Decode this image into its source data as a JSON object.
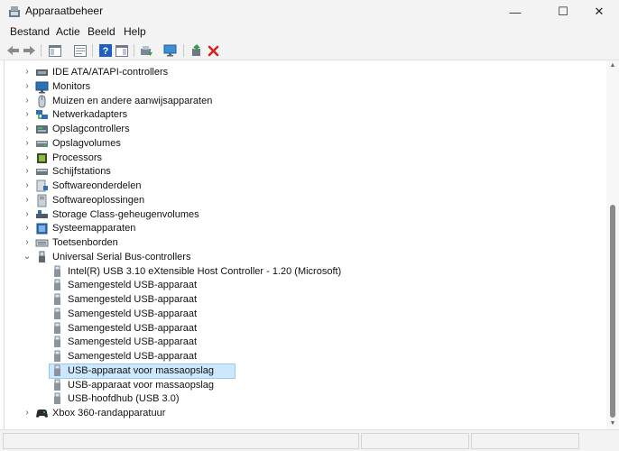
{
  "window": {
    "title": "Apparaatbeheer",
    "min": "—",
    "max": "☐",
    "close": "✕"
  },
  "menu": [
    "Bestand",
    "Actie",
    "Beeld",
    "Help"
  ],
  "toolbar": {
    "items": [
      "back-icon",
      "forward-icon",
      "show-hide-tree-icon",
      "properties-icon",
      "help-icon",
      "action-pane-icon",
      "update-driver-icon",
      "scan-hardware-icon",
      "enable-device-icon",
      "uninstall-icon"
    ]
  },
  "tree": [
    {
      "label": "IDE ATA/ATAPI-controllers",
      "icon": "ide-controller-icon",
      "level": 0,
      "chevron": "›"
    },
    {
      "label": "Monitors",
      "icon": "monitor-icon",
      "level": 0,
      "chevron": "›"
    },
    {
      "label": "Muizen en andere aanwijsapparaten",
      "icon": "mouse-icon",
      "level": 0,
      "chevron": "›"
    },
    {
      "label": "Netwerkadapters",
      "icon": "network-adapter-icon",
      "level": 0,
      "chevron": "›"
    },
    {
      "label": "Opslagcontrollers",
      "icon": "storage-controller-icon",
      "level": 0,
      "chevron": "›"
    },
    {
      "label": "Opslagvolumes",
      "icon": "storage-volume-icon",
      "level": 0,
      "chevron": "›"
    },
    {
      "label": "Processors",
      "icon": "processor-icon",
      "level": 0,
      "chevron": "›"
    },
    {
      "label": "Schijfstations",
      "icon": "disk-drive-icon",
      "level": 0,
      "chevron": "›"
    },
    {
      "label": "Softwareonderdelen",
      "icon": "software-component-icon",
      "level": 0,
      "chevron": "›"
    },
    {
      "label": "Softwareoplossingen",
      "icon": "software-solution-icon",
      "level": 0,
      "chevron": "›"
    },
    {
      "label": "Storage Class-geheugenvolumes",
      "icon": "storage-class-memory-icon",
      "level": 0,
      "chevron": "›"
    },
    {
      "label": "Systeemapparaten",
      "icon": "system-device-icon",
      "level": 0,
      "chevron": "›"
    },
    {
      "label": "Toetsenborden",
      "icon": "keyboard-icon",
      "level": 0,
      "chevron": "›"
    },
    {
      "label": "Universal Serial Bus-controllers",
      "icon": "usb-controller-icon",
      "level": 0,
      "chevron": "⌄"
    },
    {
      "label": "Intel(R) USB 3.10 eXtensible Host Controller - 1.20 (Microsoft)",
      "icon": "usb-device-icon",
      "level": 1
    },
    {
      "label": "Samengesteld USB-apparaat",
      "icon": "usb-device-icon",
      "level": 1
    },
    {
      "label": "Samengesteld USB-apparaat",
      "icon": "usb-device-icon",
      "level": 1
    },
    {
      "label": "Samengesteld USB-apparaat",
      "icon": "usb-device-icon",
      "level": 1
    },
    {
      "label": "Samengesteld USB-apparaat",
      "icon": "usb-device-icon",
      "level": 1
    },
    {
      "label": "Samengesteld USB-apparaat",
      "icon": "usb-device-icon",
      "level": 1
    },
    {
      "label": "Samengesteld USB-apparaat",
      "icon": "usb-device-icon",
      "level": 1
    },
    {
      "label": "USB-apparaat voor massaopslag",
      "icon": "usb-device-icon",
      "level": 1,
      "selected": true
    },
    {
      "label": "USB-apparaat voor massaopslag",
      "icon": "usb-device-icon",
      "level": 1
    },
    {
      "label": "USB-hoofdhub (USB 3.0)",
      "icon": "usb-device-icon",
      "level": 1
    },
    {
      "label": "Xbox 360-randapparatuur",
      "icon": "gamepad-icon",
      "level": 0,
      "chevron": "›"
    }
  ],
  "colors": {
    "selection": "#cce8ff",
    "selection_border": "#99c9ef",
    "accent": "#0067c0"
  }
}
